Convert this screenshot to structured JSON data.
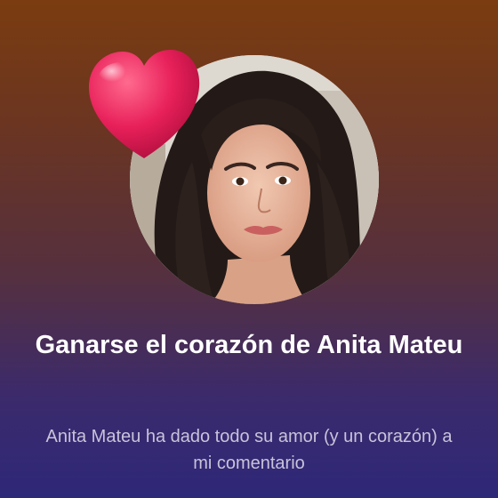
{
  "notification": {
    "title": "Ganarse el corazón de Anita Mateu",
    "description": "Anita Mateu ha dado todo su amor (y un corazón) a mi comentario"
  },
  "icons": {
    "badge": "heart-icon",
    "profile": "profile-photo"
  },
  "colors": {
    "background_top": "#7a3c10",
    "background_bottom": "#2e2878",
    "heart": "#e8205a",
    "title_text": "#ffffff",
    "description_text": "#c9c3d9"
  }
}
